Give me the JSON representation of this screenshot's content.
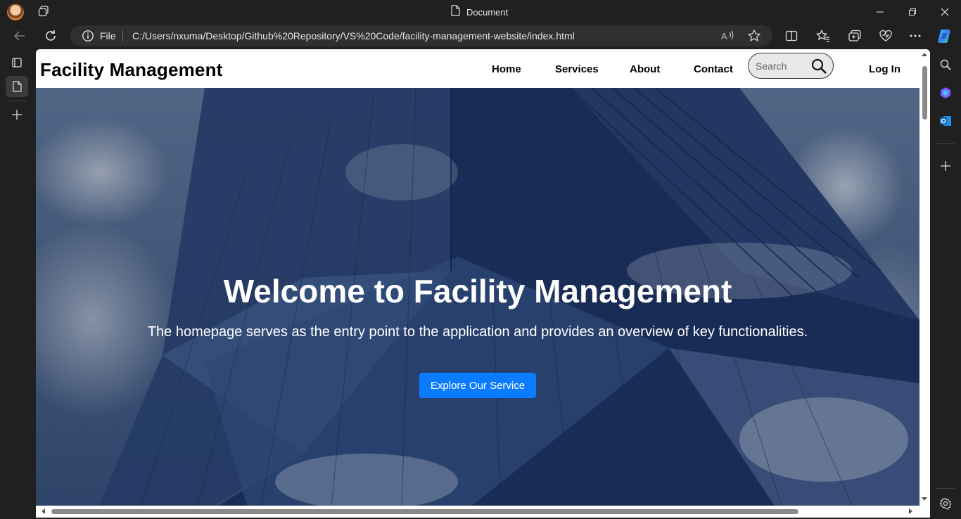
{
  "browser": {
    "tab_title": "Document",
    "address": {
      "scheme_label": "File",
      "url": "C:/Users/nxuma/Desktop/Github%20Repository/VS%20Code/facility-management-website/index.html"
    }
  },
  "site": {
    "logo": "Facility Management",
    "nav": [
      {
        "label": "Home"
      },
      {
        "label": "Services"
      },
      {
        "label": "About"
      },
      {
        "label": "Contact"
      }
    ],
    "search_placeholder": "Search",
    "login_label": "Log In"
  },
  "hero": {
    "title": "Welcome to Facility Management",
    "subtitle": "The homepage serves as the entry point to the application and provides an overview of key functionalities.",
    "cta_label": "Explore Our Service",
    "cta_color": "#0b7bff"
  },
  "icons": {
    "toolbar_right": [
      "read-aloud-icon",
      "favorite-star-icon",
      "split-screen-icon",
      "favorites-icon",
      "collections-icon",
      "browser-essentials-icon",
      "more-icon",
      "copilot-icon"
    ],
    "right_sidebar": [
      "search-icon",
      "copilot-sidebar-icon",
      "outlook-icon",
      "add-icon",
      "settings-icon"
    ]
  }
}
